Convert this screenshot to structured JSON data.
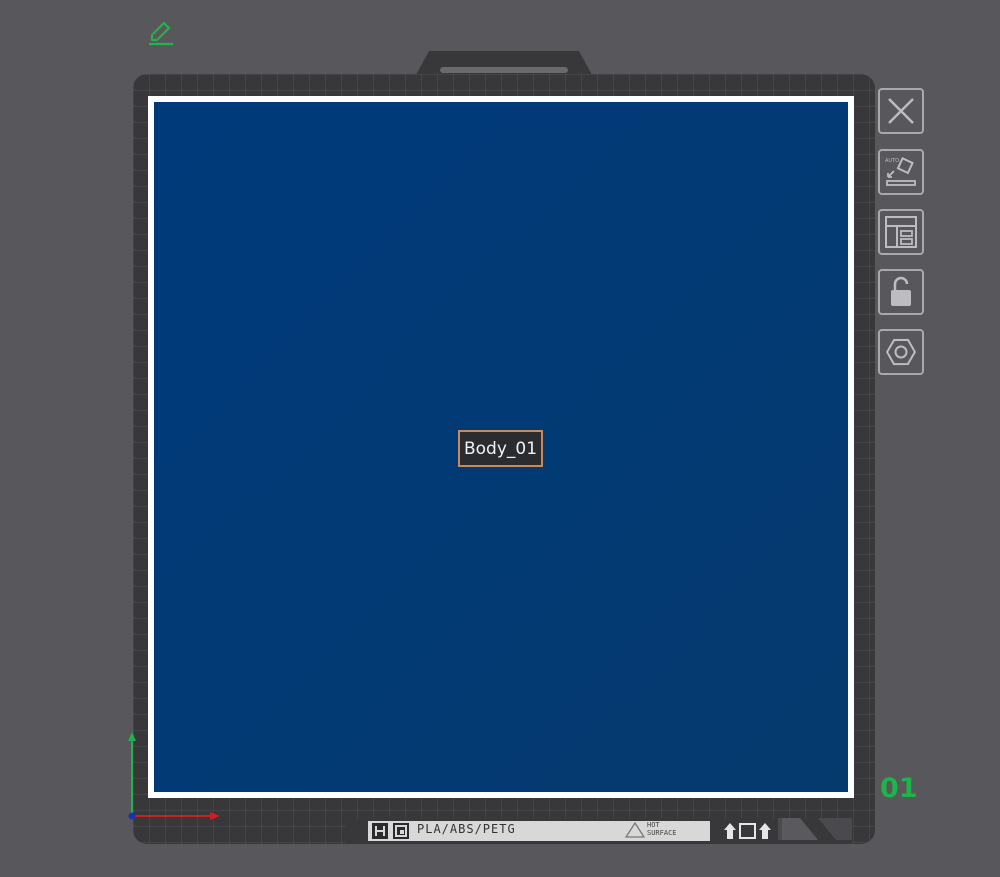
{
  "toolbar": {
    "edit_icon": "pencil-icon",
    "accent_color": "#1fb34a"
  },
  "plate": {
    "object_label": "Body_01",
    "plate_number": "01",
    "print_area_color": "#003a78"
  },
  "side_tools": [
    {
      "name": "close-icon"
    },
    {
      "name": "auto-orient-icon",
      "text": "AUTO"
    },
    {
      "name": "arrange-icon"
    },
    {
      "name": "lock-icon"
    },
    {
      "name": "settings-icon"
    }
  ],
  "plate_strip": {
    "material": "PLA/ABS/PETG",
    "warning_line1": "HOT",
    "warning_line2": "SURFACE"
  },
  "axes": {
    "x_color": "#cc1f1f",
    "y_color": "#22b14c"
  }
}
